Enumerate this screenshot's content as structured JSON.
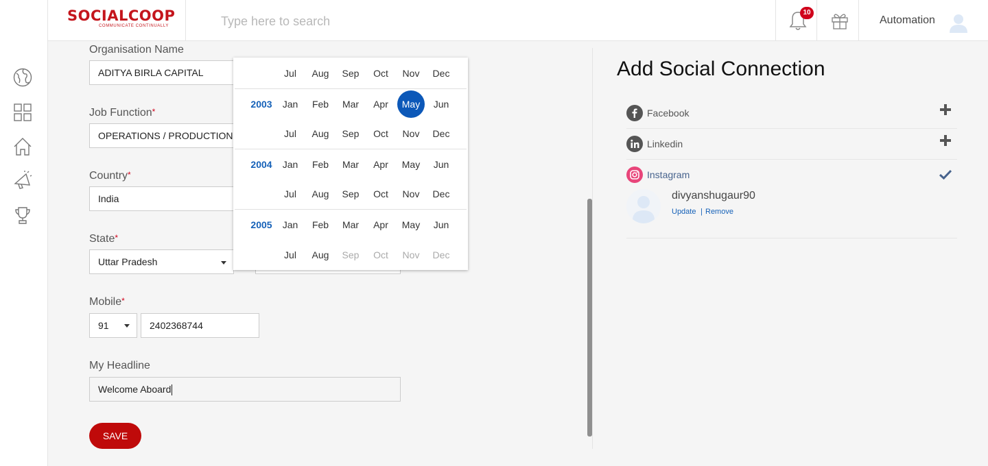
{
  "header": {
    "logo_text": "SOCIALCOOP",
    "logo_tagline": "COMMUNICATE CONTINUALLY",
    "search_placeholder": "Type here to search",
    "notification_count": "10",
    "username": "Automation"
  },
  "nav": {
    "items": [
      "globe-icon",
      "dashboard-grid-icon",
      "home-icon",
      "campaign-megaphone-icon",
      "trophy-icon"
    ]
  },
  "form": {
    "organisation": {
      "label": "Organisation Name",
      "value": "ADITYA BIRLA CAPITAL"
    },
    "job_function": {
      "label": "Job Function",
      "required": "*",
      "value": "OPERATIONS / PRODUCTION"
    },
    "country": {
      "label": "Country",
      "required": "*",
      "value": "India"
    },
    "state": {
      "label": "State",
      "required": "*",
      "value": "Uttar Pradesh"
    },
    "mobile": {
      "label": "Mobile",
      "required": "*",
      "code": "91",
      "number": "2402368744"
    },
    "headline": {
      "label": "My Headline",
      "value": "Welcome Aboard"
    },
    "save_label": "SAVE"
  },
  "month_picker": {
    "top_partial_row": [
      "Jul",
      "Aug",
      "Sep",
      "Oct",
      "Nov",
      "Dec"
    ],
    "years": [
      {
        "year": "2003",
        "first_half": [
          "Jan",
          "Feb",
          "Mar",
          "Apr",
          "May",
          "Jun"
        ],
        "second_half": [
          "Jul",
          "Aug",
          "Sep",
          "Oct",
          "Nov",
          "Dec"
        ]
      },
      {
        "year": "2004",
        "first_half": [
          "Jan",
          "Feb",
          "Mar",
          "Apr",
          "May",
          "Jun"
        ],
        "second_half": [
          "Jul",
          "Aug",
          "Sep",
          "Oct",
          "Nov",
          "Dec"
        ]
      },
      {
        "year": "2005",
        "first_half": [
          "Jan",
          "Feb",
          "Mar",
          "Apr",
          "May",
          "Jun"
        ],
        "second_half": [
          "Jul",
          "Aug",
          "Sep",
          "Oct",
          "Nov",
          "Dec"
        ]
      }
    ],
    "selected": "May 2003",
    "disabled": [
      "Sep 2005",
      "Oct 2005",
      "Nov 2005",
      "Dec 2005"
    ],
    "accent_color": "#0c58b8"
  },
  "social": {
    "title": "Add Social Connection",
    "connections": [
      {
        "name": "Facebook",
        "status": "add",
        "icon": "facebook-icon"
      },
      {
        "name": "Linkedin",
        "status": "add",
        "icon": "linkedin-icon"
      },
      {
        "name": "Instagram",
        "status": "connected",
        "icon": "instagram-icon"
      }
    ],
    "connected_account": {
      "username": "divyanshugaur90",
      "update_label": "Update",
      "separator": "|",
      "remove_label": "Remove"
    }
  },
  "colors": {
    "brand": "#c4151c",
    "save_button": "#bf0a0a",
    "link": "#1561b8",
    "check": "#47638d"
  }
}
